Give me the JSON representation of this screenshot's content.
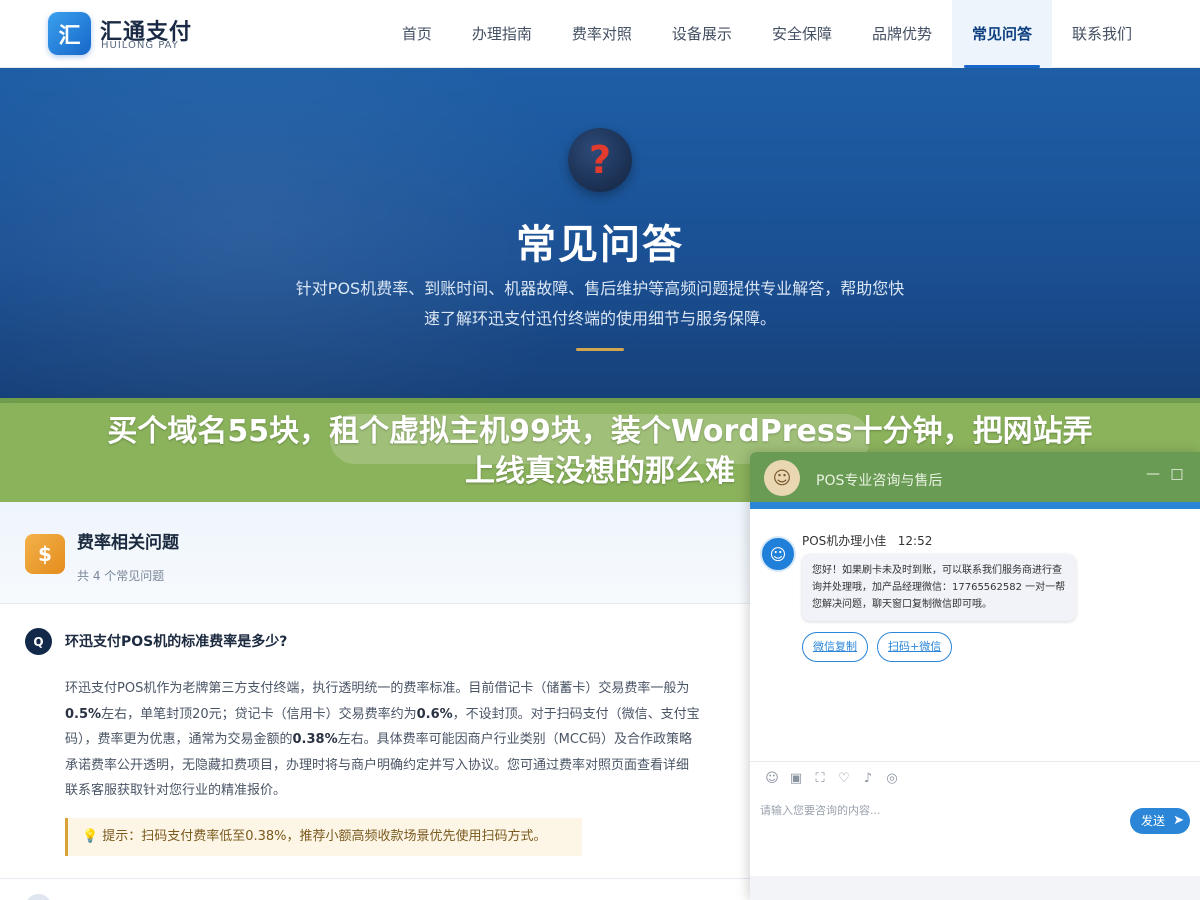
{
  "header": {
    "logo_char": "汇",
    "brand_name": "汇通支付",
    "brand_sub": "HUILONG PAY",
    "nav": [
      {
        "label": "首页"
      },
      {
        "label": "办理指南"
      },
      {
        "label": "费率对照"
      },
      {
        "label": "设备展示"
      },
      {
        "label": "安全保障"
      },
      {
        "label": "品牌优势"
      },
      {
        "label": "常见问答"
      },
      {
        "label": "联系我们"
      }
    ],
    "active_nav": "常见问答"
  },
  "hero": {
    "icon_glyph": "?",
    "title": "常见问答",
    "desc_line1": "针对POS机费率、到账时间、机器故障、售后维护等高频问题提供专业解答，帮助您快",
    "desc_line2": "速了解环迅支付迅付终端的使用细节与服务保障。"
  },
  "overlay": {
    "line1": "买个域名55块，租个虚拟主机99块，装个WordPress十分钟，把网站弄",
    "line2": "上线真没想的那么难"
  },
  "faq": {
    "category_icon": "$",
    "category_title": "费率相关问题",
    "category_count": "共 4 个常见问题",
    "q_badge": "Q",
    "question": "环迅支付POS机的标准费率是多少?",
    "answer": {
      "l1": "环迅支付POS机作为老牌第三方支付终端，执行透明统一的费率标准。目前借记卡（储蓄卡）交易费率一般为",
      "l2_b1": "0.5%",
      "l2_t1": "左右，单笔封顶20元；贷记卡（信用卡）交易费率约为",
      "l2_b2": "0.6%",
      "l2_t2": "，不设封顶。对于扫码支付（微信、支付宝",
      "l3_t1": "码），费率更为优惠，通常为交易金额的",
      "l3_b1": "0.38%",
      "l3_t2": "左右。具体费率可能因商户行业类别（MCC码）及合作政策略",
      "l4": "承诺费率公开透明，无隐藏扣费项目，办理时将与商户明确约定并写入协议。您可通过费率对照页面查看详细",
      "l5": "联系客服获取针对您行业的精准报价。"
    },
    "tip": "提示：扫码支付费率低至0.38%，推荐小额高频收款场景优先使用扫码方式。"
  },
  "chat": {
    "title": "POS专业咨询与售后",
    "minimize": "—",
    "maximize": "□",
    "agent_name": "POS机办理小佳",
    "time": "12:52",
    "message": "您好！如果刷卡未及时到账，可以联系我们服务商进行查询并处理哦，加产品经理微信：17765562582 一对一帮您解决问题，聊天窗口复制微信即可哦。",
    "quick_buttons": [
      {
        "label": "微信复制"
      },
      {
        "label": "扫码+微信"
      }
    ],
    "tools": [
      {
        "icon": "emoji-icon",
        "glyph": "☺"
      },
      {
        "icon": "image-icon",
        "glyph": "▣"
      },
      {
        "icon": "screenshot-icon",
        "glyph": "⛶"
      },
      {
        "icon": "rating-icon",
        "glyph": "♡"
      },
      {
        "icon": "volume-icon",
        "glyph": "♪"
      },
      {
        "icon": "wechat-icon",
        "glyph": "◎"
      }
    ],
    "input_placeholder": "请输入您要咨询的内容...",
    "send_label": "发送",
    "send_icon": "➤"
  }
}
